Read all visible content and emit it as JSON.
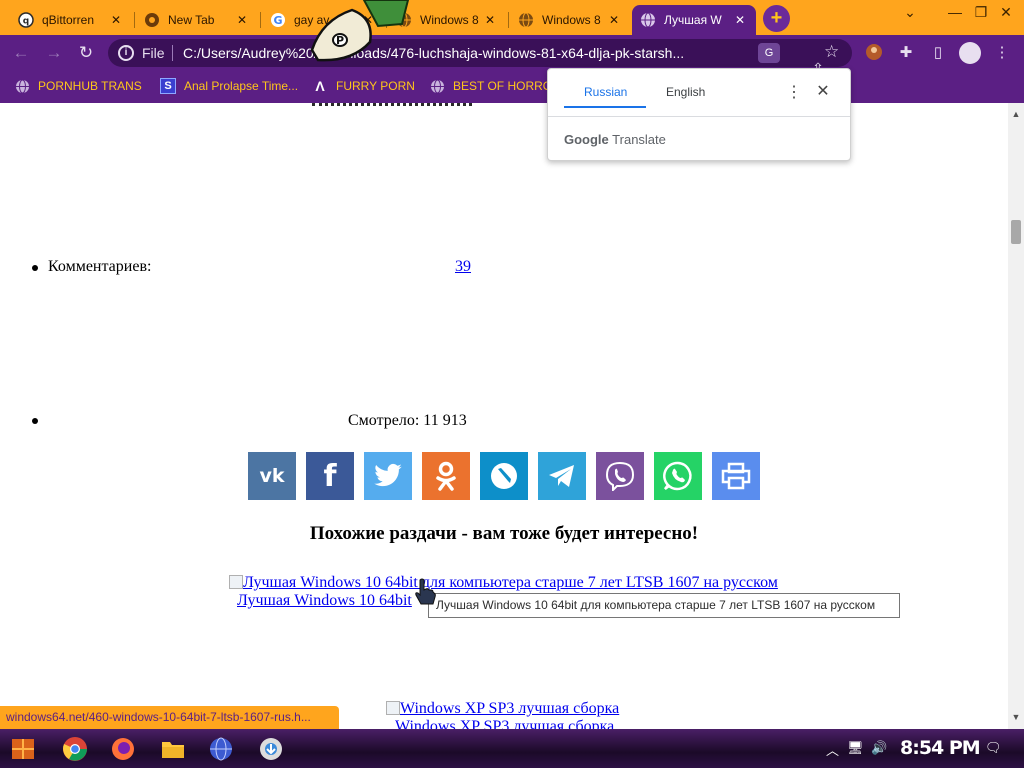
{
  "browser": {
    "tabs": [
      {
        "title": "qBittorren",
        "favicon": "qbittorrent-icon",
        "active": false
      },
      {
        "title": "New Tab",
        "favicon": "chrome-icon",
        "active": false
      },
      {
        "title": "gay av",
        "favicon": "google-icon",
        "active": false
      },
      {
        "title": "Windows 8",
        "favicon": "globe-icon",
        "active": false
      },
      {
        "title": "Windows 8",
        "favicon": "globe-icon",
        "active": false
      },
      {
        "title": "Лучшая W",
        "favicon": "globe-icon",
        "active": true
      }
    ],
    "new_tab_label": "+",
    "address": {
      "scheme_label": "File",
      "url": "C:/Users/Audrey%20/Downloads/476-luchshaja-windows-81-x64-dlja-pk-starsh..."
    },
    "bookmarks": [
      {
        "label": "PORNHUB TRANS",
        "icon": "globe-icon"
      },
      {
        "label": "Anal Prolapse Time...",
        "icon": "bookmark-s-icon"
      },
      {
        "label": "FURRY PORN",
        "icon": "lambda-icon"
      },
      {
        "label": "BEST OF HORRO",
        "icon": "globe-icon"
      }
    ]
  },
  "translate_popup": {
    "languages": [
      "Russian",
      "English"
    ],
    "selected_language": "Russian",
    "brand_google": "Google",
    "brand_translate": "Translate"
  },
  "page": {
    "comments_label": "Комментариев:",
    "comments_count": "39",
    "views_label": "Смотрело: 11 913",
    "share_buttons": [
      {
        "name": "vk",
        "color": "#4c75a3"
      },
      {
        "name": "facebook",
        "color": "#3b5998"
      },
      {
        "name": "twitter",
        "color": "#55acee"
      },
      {
        "name": "odnoklassniki",
        "color": "#eb722e"
      },
      {
        "name": "livejournal",
        "color": "#0d8fc9"
      },
      {
        "name": "telegram",
        "color": "#2fa3d9"
      },
      {
        "name": "viber",
        "color": "#7b519d"
      },
      {
        "name": "whatsapp",
        "color": "#25d366"
      },
      {
        "name": "print",
        "color": "#5a8dee"
      }
    ],
    "similar_heading": "Похожие раздачи - вам тоже будет интересно!",
    "related": [
      {
        "image_alt": "Лучшая Windows 10 64bit для компьютера старше 7 лет LTSB 1607 на русском",
        "caption": "Лучшая Windows 10 64bit"
      },
      {
        "image_alt": "Windows XP SP3 лучшая сборка",
        "caption": "Windows XP SP3 лучшая сборка"
      }
    ]
  },
  "tooltip": "Лучшая Windows 10 64bit для компьютера старше 7 лет LTSB 1607 на русском",
  "status_url": "windows64.net/460-windows-10-64bit-7-ltsb-1607-rus.h...",
  "taskbar": {
    "apps": [
      "start-icon",
      "chrome-icon",
      "firefox-icon",
      "file-explorer-icon",
      "network-globe-icon",
      "installer-icon"
    ],
    "clock": "8:54 PM",
    "colors": {
      "accent": "#ffa51d",
      "toolbar": "#5b1f84"
    }
  }
}
